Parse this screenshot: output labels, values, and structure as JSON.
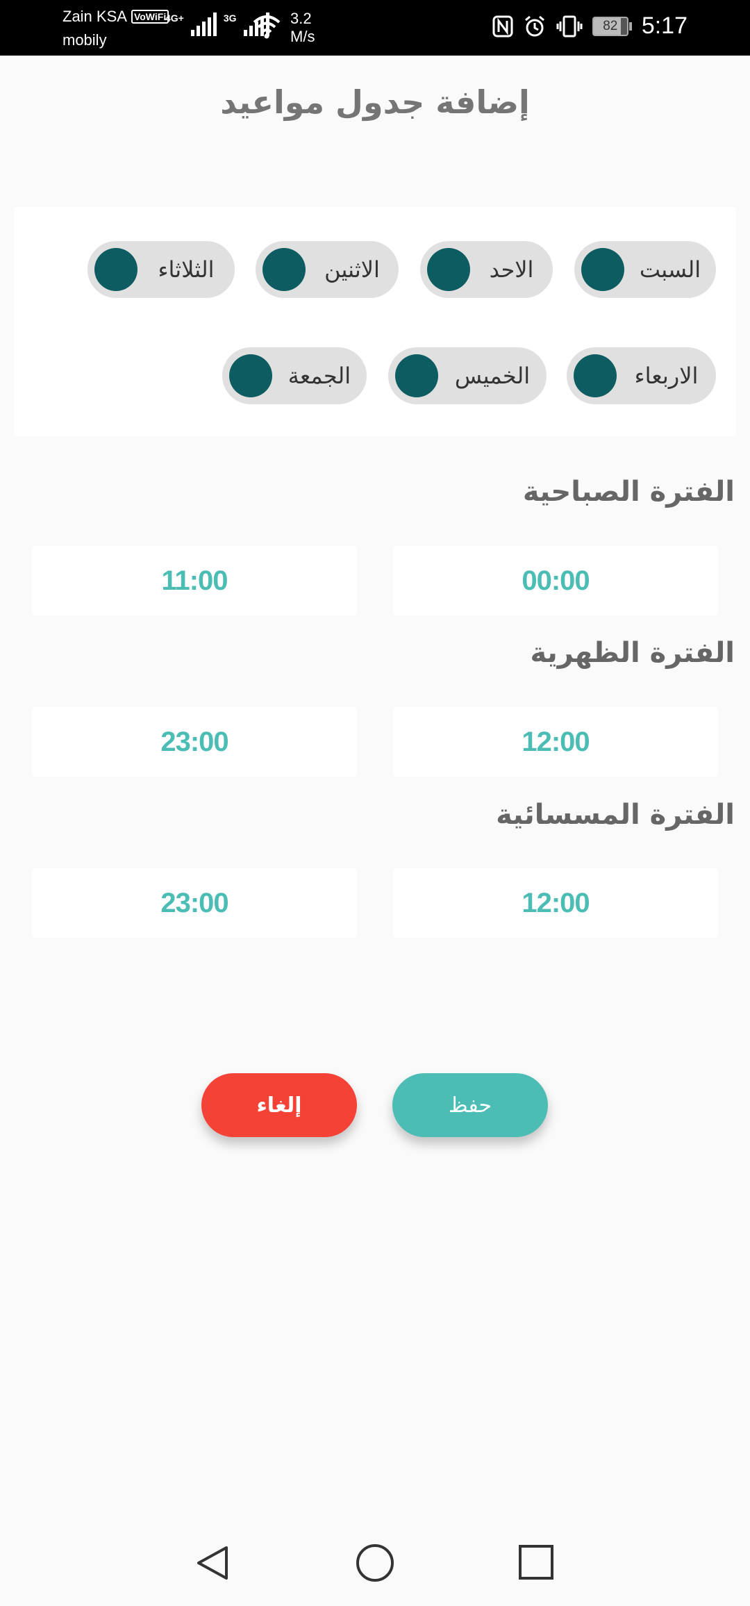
{
  "status_bar": {
    "carrier_line1": "Zain KSA",
    "vowifi": "VoWiFi",
    "carrier_line2": "mobily",
    "net1": "4G+",
    "net2": "3G",
    "speed_value": "3.2",
    "speed_unit": "M/s",
    "battery": "82",
    "battery_level": 0.82,
    "time": "5:17"
  },
  "header": {
    "title": "إضافة جدول مواعيد"
  },
  "days": [
    {
      "label": "السبت"
    },
    {
      "label": "الاحد"
    },
    {
      "label": "الاثنين"
    },
    {
      "label": "الثلاثاء"
    },
    {
      "label": "الاربعاء"
    },
    {
      "label": "الخميس"
    },
    {
      "label": "الجمعة"
    }
  ],
  "periods": [
    {
      "title": "الفترة الصباحية",
      "from": "00:00",
      "to": "11:00"
    },
    {
      "title": "الفترة الظهرية",
      "from": "12:00",
      "to": "23:00"
    },
    {
      "title": "الفترة المسسائية",
      "from": "12:00",
      "to": "23:00"
    }
  ],
  "actions": {
    "save": "حفظ",
    "cancel": "إلغاء"
  },
  "colors": {
    "accent": "#4bbdb5",
    "toggle_knob": "#0c5c62",
    "cancel": "#f44336"
  }
}
